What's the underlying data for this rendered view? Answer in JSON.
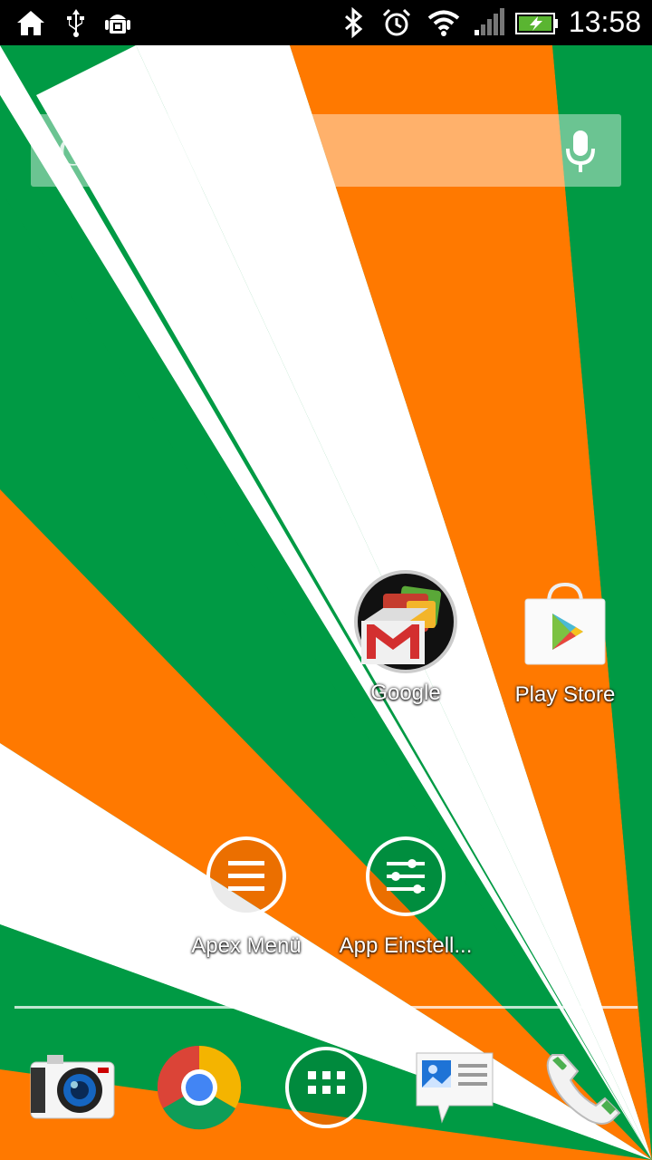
{
  "status_bar": {
    "left_icons": [
      "home-icon",
      "usb-icon",
      "android-debug-icon"
    ],
    "right_icons": [
      "bluetooth-icon",
      "alarm-icon",
      "wifi-icon",
      "signal-icon",
      "battery-charging-icon"
    ],
    "time": "13:58"
  },
  "search": {
    "placeholder": "Google",
    "icon": "mic-icon"
  },
  "home": {
    "apps": [
      {
        "label": "Google",
        "icon": "google-folder-icon"
      },
      {
        "label": "Play Store",
        "icon": "play-store-icon"
      },
      {
        "label": "Apex Menü",
        "icon": "apex-menu-icon"
      },
      {
        "label": "App Einstell...",
        "icon": "app-settings-icon"
      }
    ]
  },
  "dock": {
    "items": [
      {
        "name": "camera",
        "icon": "camera-icon"
      },
      {
        "name": "chrome",
        "icon": "chrome-icon"
      },
      {
        "name": "app-drawer",
        "icon": "app-drawer-icon"
      },
      {
        "name": "messages",
        "icon": "messages-icon"
      },
      {
        "name": "phone",
        "icon": "phone-icon"
      }
    ]
  },
  "colors": {
    "green": "#009a44",
    "orange": "#ff7900",
    "white": "#ffffff",
    "status_bar": "#000000"
  }
}
